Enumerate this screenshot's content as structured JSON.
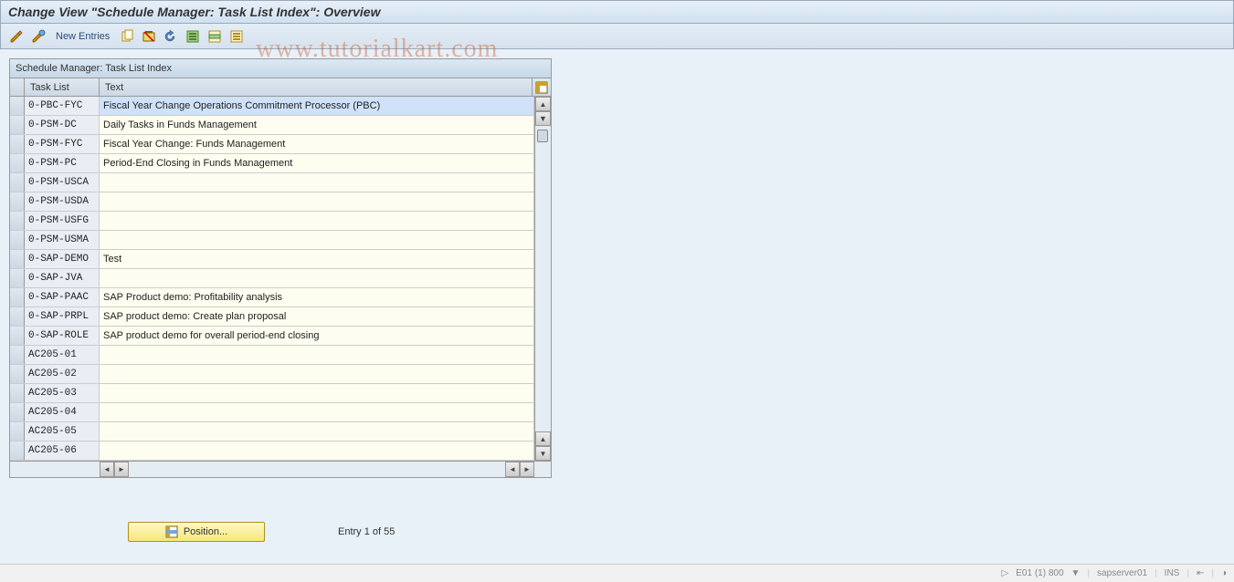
{
  "title": "Change View \"Schedule Manager: Task List Index\": Overview",
  "toolbar": {
    "new_entries": "New Entries"
  },
  "watermark": "www.tutorialkart.com",
  "table": {
    "title": "Schedule Manager: Task List Index",
    "col_tasklist": "Task List",
    "col_text": "Text",
    "rows": [
      {
        "tasklist": "0-PBC-FYC",
        "text": "Fiscal Year Change Operations Commitment Processor (PBC)",
        "selected": true
      },
      {
        "tasklist": "0-PSM-DC",
        "text": "Daily Tasks in Funds Management",
        "selected": false
      },
      {
        "tasklist": "0-PSM-FYC",
        "text": "Fiscal Year Change: Funds Management",
        "selected": false
      },
      {
        "tasklist": "0-PSM-PC",
        "text": "Period-End Closing in Funds Management",
        "selected": false
      },
      {
        "tasklist": "0-PSM-USCA",
        "text": "",
        "selected": false
      },
      {
        "tasklist": "0-PSM-USDA",
        "text": "",
        "selected": false
      },
      {
        "tasklist": "0-PSM-USFG",
        "text": "",
        "selected": false
      },
      {
        "tasklist": "0-PSM-USMA",
        "text": "",
        "selected": false
      },
      {
        "tasklist": "0-SAP-DEMO",
        "text": "Test",
        "selected": false
      },
      {
        "tasklist": "0-SAP-JVA",
        "text": "",
        "selected": false
      },
      {
        "tasklist": "0-SAP-PAAC",
        "text": "SAP Product demo: Profitability analysis",
        "selected": false
      },
      {
        "tasklist": "0-SAP-PRPL",
        "text": "SAP product demo: Create plan proposal",
        "selected": false
      },
      {
        "tasklist": "0-SAP-ROLE",
        "text": "SAP product demo for overall period-end closing",
        "selected": false
      },
      {
        "tasklist": "AC205-01",
        "text": "",
        "selected": false
      },
      {
        "tasklist": "AC205-02",
        "text": "",
        "selected": false
      },
      {
        "tasklist": "AC205-03",
        "text": "",
        "selected": false
      },
      {
        "tasklist": "AC205-04",
        "text": "",
        "selected": false
      },
      {
        "tasklist": "AC205-05",
        "text": "",
        "selected": false
      },
      {
        "tasklist": "AC205-06",
        "text": "",
        "selected": false
      }
    ]
  },
  "position_button": "Position...",
  "entry_counter": "Entry 1 of 55",
  "status": {
    "system": "E01 (1) 800",
    "server": "sapserver01",
    "mode": "INS"
  }
}
